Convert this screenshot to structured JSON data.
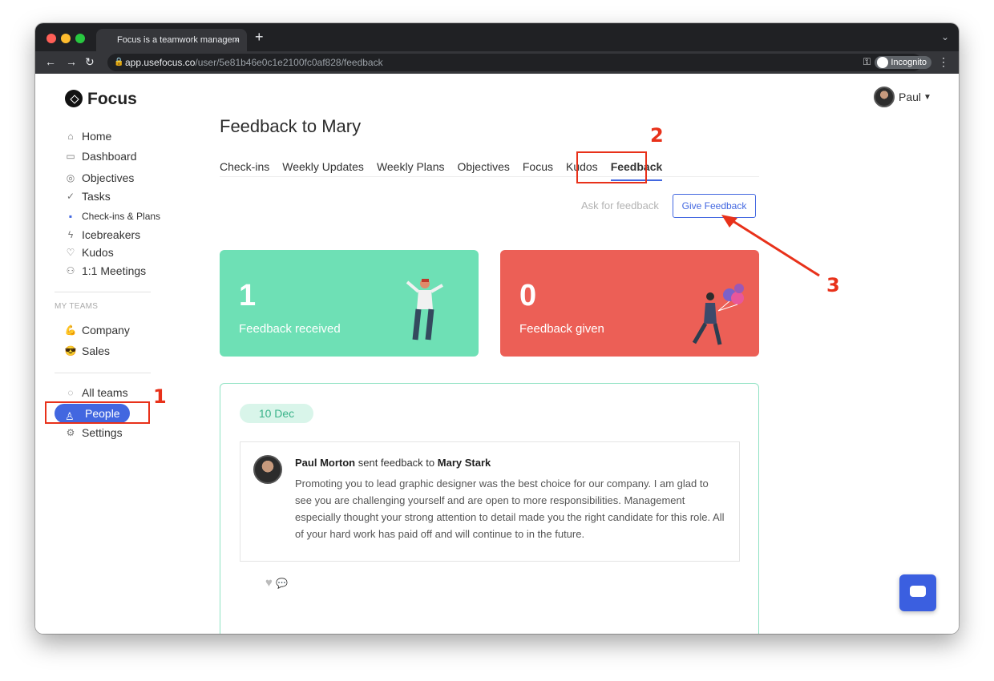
{
  "browser": {
    "tab_title": "Focus is a teamwork managem",
    "tab_close": "×",
    "new_tab": "+",
    "url_host": "app.usefocus.co",
    "url_path": "/user/5e81b46e0c1e2100fc0af828/feedback",
    "incognito_label": "Incognito"
  },
  "app": {
    "brand": "Focus",
    "user_name": "Paul"
  },
  "sidebar": {
    "items": [
      {
        "label": "Home",
        "icon": "home-icon"
      },
      {
        "label": "Dashboard",
        "icon": "dashboard-icon"
      },
      {
        "label": "Objectives",
        "icon": "objectives-icon"
      },
      {
        "label": "Tasks",
        "icon": "tasks-icon"
      },
      {
        "label": "Check-ins & Plans",
        "icon": "checkins-icon"
      },
      {
        "label": "Icebreakers",
        "icon": "lightning-icon"
      },
      {
        "label": "Kudos",
        "icon": "kudos-icon"
      },
      {
        "label": "1:1 Meetings",
        "icon": "meetings-icon"
      }
    ],
    "teams_header": "MY TEAMS",
    "teams": [
      {
        "label": "Company",
        "emoji": "💪"
      },
      {
        "label": "Sales",
        "emoji": "😎"
      }
    ],
    "bottom": [
      {
        "label": "All teams",
        "icon": "all-teams-icon"
      },
      {
        "label": "People",
        "icon": "people-icon"
      },
      {
        "label": "Settings",
        "icon": "gear-icon"
      }
    ]
  },
  "main": {
    "title": "Feedback to Mary",
    "tabs": [
      "Check-ins",
      "Weekly Updates",
      "Weekly Plans",
      "Objectives",
      "Focus",
      "Kudos",
      "Feedback"
    ],
    "active_tab": "Feedback",
    "ask_label": "Ask for feedback",
    "give_label": "Give Feedback"
  },
  "stats": [
    {
      "value": "1",
      "label": "Feedback received",
      "color": "#6ee0b5"
    },
    {
      "value": "0",
      "label": "Feedback given",
      "color": "#ec5f56"
    }
  ],
  "feedback": {
    "date": "10 Dec",
    "sender": "Paul Morton",
    "verb": "sent feedback to",
    "recipient": "Mary Stark",
    "text": "Promoting you to lead graphic designer was the best choice for our company. I am glad to see you are challenging yourself and are open to more responsibilities. Management especially thought your strong attention to detail made you the right candidate for this role. All of your hard work has paid off and will continue to in the future."
  },
  "annotations": {
    "one": "1",
    "two": "2",
    "three": "3",
    "color": "#e8311a"
  }
}
